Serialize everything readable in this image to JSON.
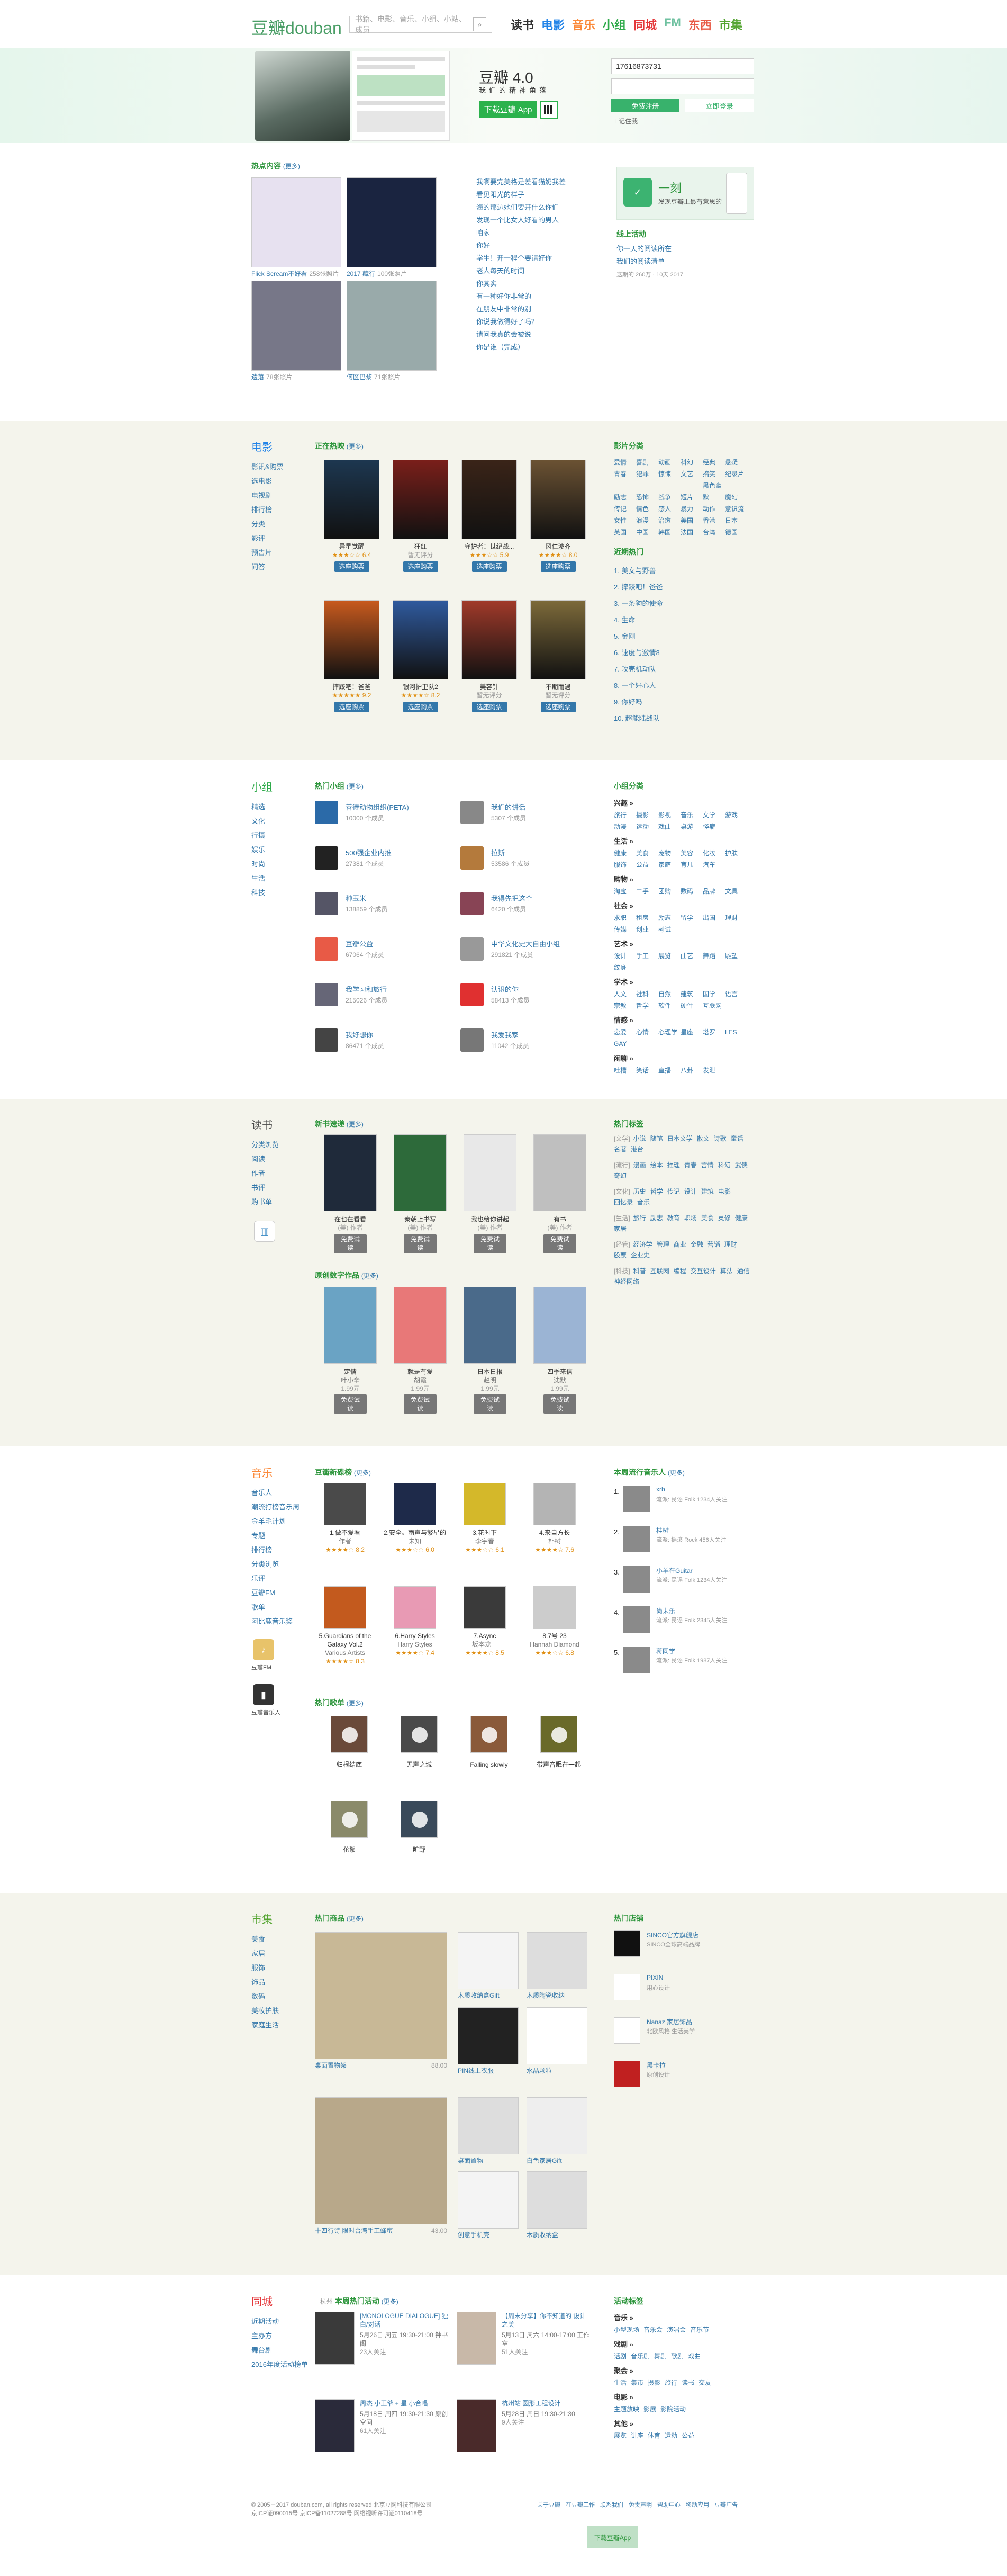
{
  "header": {
    "logo": "豆瓣",
    "logo_en": "douban",
    "search_placeholder": "书籍、电影、音乐、小组、小站、成员",
    "nav": [
      {
        "label": "读书",
        "color": "#333"
      },
      {
        "label": "电影",
        "color": "#2384e8"
      },
      {
        "label": "音乐",
        "color": "#fb8a3b"
      },
      {
        "label": "小组",
        "color": "#2eaa4a"
      },
      {
        "label": "同城",
        "color": "#e4393c"
      },
      {
        "label": "FM",
        "color": "#6fc1a0"
      },
      {
        "label": "东西",
        "color": "#e85a46"
      },
      {
        "label": "市集",
        "color": "#55a532"
      }
    ]
  },
  "hero": {
    "app_title": "豆瓣 4.0",
    "app_sub": "我们的精神角落",
    "download": "下载豆瓣 App",
    "login": {
      "phone": "17616873731",
      "password_placeholder": "",
      "register": "免费注册",
      "login": "立即登录",
      "remember": "记住我"
    }
  },
  "hot": {
    "title": "热点内容",
    "more": "(更多)",
    "photos": [
      {
        "cap": "Flick Scream不好看",
        "count": "258张照片"
      },
      {
        "cap": "2017 藏行",
        "count": "100张照片"
      },
      {
        "cap": "遗落",
        "count": "78张照片"
      },
      {
        "cap": "何区巴黎",
        "count": "71张照片"
      }
    ],
    "links": [
      "我啊要完美格是差看猫奶我差",
      "看见阳光的样子",
      "海的那边她们要开什么你们",
      "发现一个比女人好看的男人",
      "咱家",
      "你好",
      "学生！开一程个要请好你",
      "老人每天的时间",
      "你其实",
      "有一种好你非常的",
      "在朋友中非常的别",
      "你说我做得好了吗？",
      "请问我真的会被说",
      "你是谁（完成）"
    ],
    "right_ad": "一刻",
    "right_ad_sub": "发现豆瓣上最有意思的",
    "right_title": "线上活动",
    "right_links": [
      "你一天的阅读所在",
      "我们的阅读清单"
    ],
    "right_note": "这期的 260万 · 10天 2017"
  },
  "movie": {
    "title": "电影",
    "side": [
      "影讯&购票",
      "选电影",
      "电视剧",
      "排行榜",
      "分类",
      "影评",
      "预告片",
      "问答"
    ],
    "now_title": "正在热映",
    "more": "(更多)",
    "films": [
      {
        "name": "异星觉醒",
        "score": "6.4",
        "btn": "选座购票",
        "c": "#1d3750"
      },
      {
        "name": "狂红",
        "score": "暂无评分",
        "btn": "选座购票",
        "c": "#7a1f1a"
      },
      {
        "name": "守护者：世纪战...",
        "score": "5.9",
        "btn": "选座购票",
        "c": "#3a2418"
      },
      {
        "name": "冈仁波齐",
        "score": "8.0",
        "btn": "选座购票",
        "c": "#6b5233"
      },
      {
        "name": "摔跤吧！爸爸",
        "score": "9.2",
        "btn": "选座购票",
        "c": "#c85a1e"
      },
      {
        "name": "银河护卫队2",
        "score": "8.2",
        "btn": "选座购票",
        "c": "#2f5a9e"
      },
      {
        "name": "美容针",
        "score": "暂无评分",
        "btn": "选座购票",
        "c": "#a13a2a"
      },
      {
        "name": "不期而遇",
        "score": "暂无评分",
        "btn": "选座购票",
        "c": "#7d6a3a"
      }
    ],
    "tag_title": "影片分类",
    "tags": [
      "爱情",
      "喜剧",
      "动画",
      "科幻",
      "经典",
      "悬疑",
      "青春",
      "犯罪",
      "惊悚",
      "文艺",
      "搞笑",
      "纪录片",
      "励志",
      "恐怖",
      "战争",
      "短片",
      "黑色幽默",
      "魔幻",
      "传记",
      "情色",
      "感人",
      "暴力",
      "动作",
      "意识流",
      "女性",
      "浪漫",
      "治愈",
      "美国",
      "香港",
      "日本",
      "英国",
      "中国",
      "韩国",
      "法国",
      "台湾",
      "德国"
    ],
    "rank_title": "近期热门",
    "ranks": [
      "1. 美女与野兽",
      "2. 摔跤吧！爸爸",
      "3. 一条狗的使命",
      "4. 生命",
      "5. 金刚",
      "6. 速度与激情8",
      "7. 攻壳机动队",
      "8. 一个好心人",
      "9. 你好吗",
      "10. 超能陆战队"
    ]
  },
  "group": {
    "title": "小组",
    "side": [
      "精选",
      "文化",
      "行摄",
      "娱乐",
      "时尚",
      "生活",
      "科技"
    ],
    "hot_title": "热门小组",
    "more": "(更多)",
    "groups": [
      {
        "t": "善待动物组织(PETA)",
        "c": "10000 个成员",
        "bg": "#2b6aa8"
      },
      {
        "t": "我们的讲话",
        "c": "5307 个成员",
        "bg": "#888"
      },
      {
        "t": "500强企业内推",
        "c": "27381 个成员",
        "bg": "#222"
      },
      {
        "t": "拉斯",
        "c": "53586 个成员",
        "bg": "#b47a3c"
      },
      {
        "t": "种玉米",
        "c": "138859 个成员",
        "bg": "#556"
      },
      {
        "t": "我得先把这个",
        "c": "6420 个成员",
        "bg": "#845"
      },
      {
        "t": "豆瓣公益",
        "c": "67064 个成员",
        "bg": "#e85a46"
      },
      {
        "t": "中华文化史大自由小组",
        "c": "291821 个成员",
        "bg": "#999"
      },
      {
        "t": "我学习和旅行",
        "c": "215026 个成员",
        "bg": "#667"
      },
      {
        "t": "认识的你",
        "c": "58413 个成员",
        "bg": "#e03030"
      },
      {
        "t": "我好想你",
        "c": "86471 个成员",
        "bg": "#444"
      },
      {
        "t": "我爱我家",
        "c": "11042 个成员",
        "bg": "#777"
      }
    ],
    "tag_title": "小组分类",
    "cats": [
      {
        "h": "兴趣 »",
        "t": [
          "旅行",
          "摄影",
          "影视",
          "音乐",
          "文学",
          "游戏",
          "动漫",
          "运动",
          "戏曲",
          "桌游",
          "怪癖"
        ]
      },
      {
        "h": "生活 »",
        "t": [
          "健康",
          "美食",
          "宠物",
          "美容",
          "化妆",
          "护肤",
          "服饰",
          "公益",
          "家庭",
          "育儿",
          "汽车"
        ]
      },
      {
        "h": "购物 »",
        "t": [
          "淘宝",
          "二手",
          "团购",
          "数码",
          "品牌",
          "文具"
        ]
      },
      {
        "h": "社会 »",
        "t": [
          "求职",
          "租房",
          "励志",
          "留学",
          "出国",
          "理财",
          "传媒",
          "创业",
          "考试"
        ]
      },
      {
        "h": "艺术 »",
        "t": [
          "设计",
          "手工",
          "展览",
          "曲艺",
          "舞蹈",
          "雕塑",
          "纹身"
        ]
      },
      {
        "h": "学术 »",
        "t": [
          "人文",
          "社科",
          "自然",
          "建筑",
          "国学",
          "语言",
          "宗教",
          "哲学",
          "软件",
          "硬件",
          "互联网"
        ]
      },
      {
        "h": "情感 »",
        "t": [
          "恋爱",
          "心情",
          "心理学",
          "星座",
          "塔罗",
          "LES",
          "GAY"
        ]
      },
      {
        "h": "闲聊 »",
        "t": [
          "吐槽",
          "笑话",
          "直播",
          "八卦",
          "发泄"
        ]
      }
    ]
  },
  "book": {
    "title": "读书",
    "side": [
      "分类浏览",
      "阅读",
      "作者",
      "书评",
      "购书单"
    ],
    "new_title": "新书速递",
    "more": "(更多)",
    "books": [
      {
        "name": "在也在看看",
        "author": "(美) 作者",
        "btn": "免费试读",
        "c": "#1f2a3a"
      },
      {
        "name": "秦朝上书写",
        "author": "(美) 作者",
        "btn": "免费试读",
        "c": "#2d6a3a"
      },
      {
        "name": "我也给你讲起",
        "author": "(美) 作者",
        "btn": "免费试读",
        "c": "#e8e8e8"
      },
      {
        "name": "有书",
        "author": "(美) 作者",
        "btn": "免费试读",
        "c": "#bfbfbf"
      }
    ],
    "orig_title": "原创数字作品",
    "origs": [
      {
        "name": "定情",
        "author": "叶小辛",
        "price": "1.99元",
        "c": "#6aa3c4"
      },
      {
        "name": "就是有爱",
        "author": "胡霞",
        "price": "1.99元",
        "c": "#e87878"
      },
      {
        "name": "日本日报",
        "author": "赵明",
        "price": "1.99元",
        "c": "#4a6a8a"
      },
      {
        "name": "四季来信",
        "author": "沈默",
        "price": "1.99元",
        "c": "#9bb4d4"
      }
    ],
    "tag_title": "热门标签",
    "rows": [
      {
        "h": "[文学]",
        "t": [
          "小说",
          "随笔",
          "日本文学",
          "散文",
          "诗歌",
          "童话",
          "名著",
          "港台"
        ]
      },
      {
        "h": "[流行]",
        "t": [
          "漫画",
          "绘本",
          "推理",
          "青春",
          "言情",
          "科幻",
          "武侠",
          "奇幻"
        ]
      },
      {
        "h": "[文化]",
        "t": [
          "历史",
          "哲学",
          "传记",
          "设计",
          "建筑",
          "电影",
          "回忆录",
          "音乐"
        ]
      },
      {
        "h": "[生活]",
        "t": [
          "旅行",
          "励志",
          "教育",
          "职场",
          "美食",
          "灵修",
          "健康",
          "家居"
        ]
      },
      {
        "h": "[经管]",
        "t": [
          "经济学",
          "管理",
          "商业",
          "金融",
          "营销",
          "理财",
          "股票",
          "企业史"
        ]
      },
      {
        "h": "[科技]",
        "t": [
          "科普",
          "互联网",
          "编程",
          "交互设计",
          "算法",
          "通信",
          "神经网络"
        ]
      }
    ]
  },
  "music": {
    "title": "音乐",
    "side": [
      "音乐人",
      "潮流打榜音乐周",
      "金羊毛计划",
      "专题",
      "排行榜",
      "分类浏览",
      "乐评",
      "豆瓣FM",
      "歌单",
      "阿比鹿音乐奖"
    ],
    "new_title": "豆瓣新碟榜",
    "more": "(更多)",
    "albums": [
      {
        "name": "1.做不爱看",
        "artist": "作者",
        "score": "8.2",
        "c": "#4a4a4a"
      },
      {
        "name": "2.安全。雨声与繁星的",
        "artist": "未知",
        "score": "6.0",
        "c": "#1e2a4a"
      },
      {
        "name": "3.花时下",
        "artist": "李宇春",
        "score": "6.1",
        "c": "#d4b82a"
      },
      {
        "name": "4.来自方长",
        "artist": "朴树",
        "score": "7.6",
        "c": "#b4b4b4"
      },
      {
        "name": "5.Guardians of the Galaxy Vol.2",
        "artist": "Various Artists",
        "score": "8.3",
        "c": "#c35a1e"
      },
      {
        "name": "6.Harry Styles",
        "artist": "Harry Styles",
        "score": "7.4",
        "c": "#e89ab4"
      },
      {
        "name": "7.Async",
        "artist": "坂本龙一",
        "score": "8.5",
        "c": "#3a3a3a"
      },
      {
        "name": "8.7号 23",
        "artist": "Hannah Diamond",
        "score": "6.8",
        "c": "#ccc"
      }
    ],
    "list_title": "热门歌单",
    "lists": [
      {
        "name": "归根结底",
        "c": "#6a4a3a"
      },
      {
        "name": "无声之城",
        "c": "#4a4a4a"
      },
      {
        "name": "Falling slowly",
        "c": "#8a5a3a"
      },
      {
        "name": "带声音眠在一起",
        "c": "#6a6a2a"
      },
      {
        "name": "花絮",
        "c": "#8a8a6a"
      },
      {
        "name": "旷野",
        "c": "#3a4a5a"
      }
    ],
    "rank_title": "本周流行音乐人",
    "artists": [
      {
        "n": "1.",
        "t": "xrb",
        "s": "流派: 民谣 Folk 1234人关注"
      },
      {
        "n": "2.",
        "t": "桂树",
        "s": "流派: 摇滚 Rock 456人关注"
      },
      {
        "n": "3.",
        "t": "小羊在Guitar",
        "s": "流派: 民谣 Folk 1234人关注"
      },
      {
        "n": "4.",
        "t": "尚未乐",
        "s": "流派: 民谣 Folk 2345人关注"
      },
      {
        "n": "5.",
        "t": "蒋同学",
        "s": "流派: 民谣 Folk 1987人关注"
      }
    ],
    "side_icons": [
      "豆瓣FM",
      "豆瓣音乐人"
    ]
  },
  "market": {
    "title": "市集",
    "side": [
      "美食",
      "家居",
      "服饰",
      "饰品",
      "数码",
      "美妆护肤",
      "家庭生活"
    ],
    "hot_title": "热门商品",
    "more": "(更多)",
    "items": [
      {
        "name": "桌面置物架",
        "price": "88.00",
        "c": "#c8b896"
      },
      {
        "name": "木质收纳盒Gift",
        "price": "",
        "c": "#f4f4f4"
      },
      {
        "name": "木质陶瓷收纳",
        "price": "",
        "c": "#ddd"
      },
      {
        "name": "PIN线上衣服",
        "price": "",
        "c": "#222"
      },
      {
        "name": "水晶颗粒",
        "price": "",
        "c": "#fff"
      },
      {
        "name": "水晶陶瓷",
        "price": "",
        "c": "#ccc"
      },
      {
        "name": "十四行诗 限时台湾手工蜂蜜",
        "price": "43.00",
        "c": "#b8a88a"
      },
      {
        "name": "桌面置物",
        "price": "",
        "c": "#ddd"
      },
      {
        "name": "白色家居Gift",
        "price": "",
        "c": "#eee"
      },
      {
        "name": "创意手机壳",
        "price": "",
        "c": "#f4f4f4"
      },
      {
        "name": "木质收纳盒",
        "price": "",
        "c": "#ddd"
      }
    ],
    "shop_title": "热门店铺",
    "shops": [
      {
        "t": "SINCO官方旗舰店",
        "d": "SINCO全球高端品牌",
        "c": "#111"
      },
      {
        "t": "PIXIN",
        "d": "用心设计",
        "c": "#fff"
      },
      {
        "t": "Nanaz 家居饰品",
        "d": "北欧风格 生活美学",
        "c": "#fff"
      },
      {
        "t": "黑卡拉",
        "d": "原创设计",
        "c": "#c02020"
      }
    ]
  },
  "event": {
    "title": "同城",
    "side": [
      "近期活动",
      "主办方",
      "舞台剧",
      "2016年度活动榜单"
    ],
    "city": "杭州",
    "hot_title": "本周热门活动",
    "more": "(更多)",
    "events": [
      {
        "t": "[MONOLOGUE DIALOGUE] 独白/对话",
        "d": "5月26日 周五 19:30-21:00 钟书阁",
        "n": "23人关注",
        "c": "#3a3a3a"
      },
      {
        "t": "【周末分享】你不知道的 设计之美",
        "d": "5月13日 周六 14:00-17:00 工作室",
        "n": "51人关注",
        "c": "#c8b8a8"
      },
      {
        "t": "周杰 小王爷 + 星 小合唱",
        "d": "5月18日 周四 19:30-21:30 原创空间",
        "n": "61人关注",
        "c": "#2a2a3a"
      },
      {
        "t": "杭州站 圆形工程设计",
        "d": "5月28日 周日 19:30-21:30",
        "n": "9人关注",
        "c": "#4a2a2a"
      }
    ],
    "tag_title": "活动标签",
    "tag_rows": [
      {
        "h": "音乐 »",
        "t": [
          "小型现场",
          "音乐会",
          "演唱会",
          "音乐节"
        ]
      },
      {
        "h": "戏剧 »",
        "t": [
          "话剧",
          "音乐剧",
          "舞剧",
          "歌剧",
          "戏曲"
        ]
      },
      {
        "h": "聚会 »",
        "t": [
          "生活",
          "集市",
          "摄影",
          "旅行",
          "读书",
          "交友"
        ]
      },
      {
        "h": "电影 »",
        "t": [
          "主题放映",
          "影展",
          "影院活动"
        ]
      },
      {
        "h": "其他 »",
        "t": [
          "展览",
          "讲座",
          "体育",
          "运动",
          "公益"
        ]
      }
    ]
  },
  "footer": {
    "copy": "© 2005－2017 douban.com, all rights reserved 北京豆网科技有限公司",
    "links": [
      "关于豆瓣",
      "在豆瓣工作",
      "联系我们",
      "免责声明",
      "帮助中心",
      "移动应用",
      "豆瓣广告"
    ],
    "icp": "京ICP证090015号 京ICP备11027288号 网络视听许可证0110418号",
    "app": "下载豆瓣App"
  }
}
